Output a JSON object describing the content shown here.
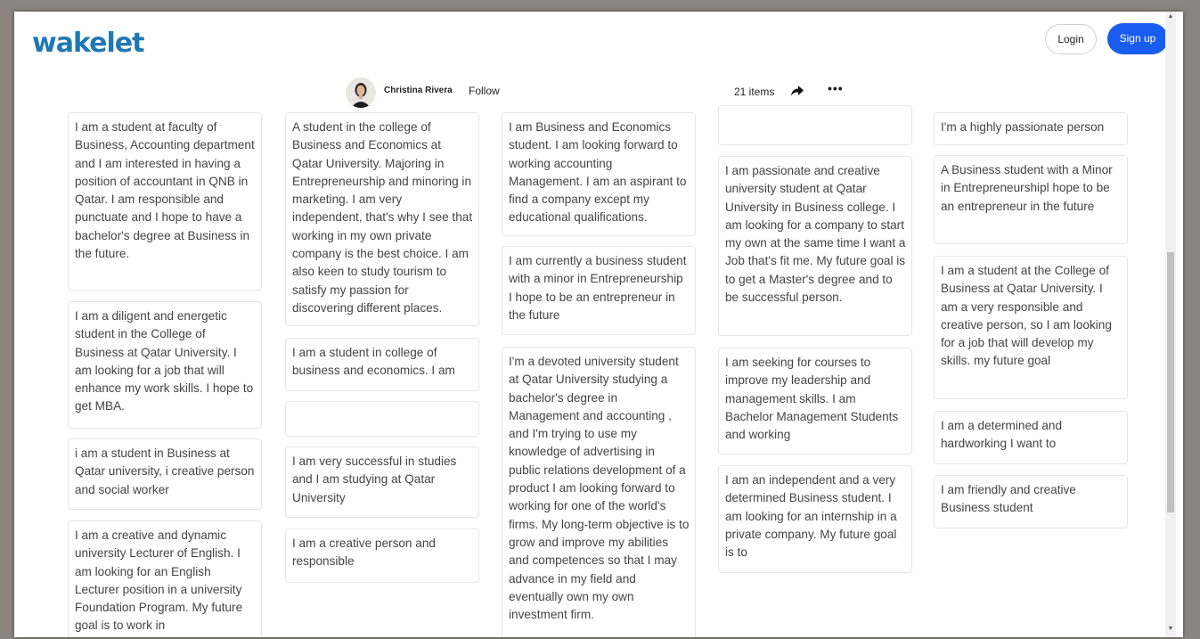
{
  "header": {
    "logo": "wakelet",
    "login_label": "Login",
    "signup_label": "Sign up"
  },
  "collection": {
    "author_name": "Christina Rivera",
    "follow_label": "Follow",
    "items_count": "21 items",
    "more_label": "•••"
  },
  "columns": [
    {
      "cards": [
        "I am a student at faculty of Business, Accounting department and I am interested in having a position of accountant in QNB in Qatar. I am responsible and punctuate and I hope to have a bachelor's degree at Business in the future.",
        "I am a diligent and energetic student in the College of Business at Qatar University. I am looking for a job that will enhance my work skills. I hope to get MBA.",
        "i am a student in Business at Qatar university, i creative person and social worker",
        "I am a creative and dynamic university Lecturer of English. I am looking for an English Lecturer position in a university Foundation Program. My future goal is to work in"
      ]
    },
    {
      "cards": [
        "A student in the college of Business and Economics at Qatar University. Majoring in Entrepreneurship and minoring in marketing. I am very independent, that's why I see that working in my own private company is the best choice. I am also keen to study tourism to satisfy my passion for discovering different places.",
        "I am a student in college of business and economics. I am",
        "",
        "I am very successful in studies and I am studying at Qatar University",
        "I am a creative person and responsible"
      ]
    },
    {
      "cards": [
        "I am Business and Economics student. I am looking forward to working accounting Management. I am an aspirant to find a company except my educational qualifications.",
        "I am currently a business student with a minor in Entrepreneurship I hope to be an entrepreneur in the future",
        "I'm a devoted university student at Qatar University studying a bachelor's degree in Management and accounting , and I'm trying to use my knowledge of advertising in public relations development of a product I am looking forward to working for one of the world's firms. My long-term objective is to grow and improve my abilities and competences so that I may advance in my field and eventually own my own investment firm."
      ]
    },
    {
      "cards": [
        "",
        "I am passionate and creative university student at Qatar University in Business college. I am looking for a company to start my own at the same time I want a Job that's fit me. My future goal is to get a Master's degree and to be successful person.",
        "I am seeking for courses to improve my leadership and management skills. I am Bachelor Management Students and working",
        "I am an independent and a very determined Business student. I am looking for an internship in a private company. My future goal is to"
      ]
    },
    {
      "cards": [
        "I'm a highly passionate person",
        "A Business student with a Minor in Entrepreneurshipl hope to be an entrepreneur in the future",
        "I am a student at the College of Business at Qatar University. I am a very responsible and creative person, so I am looking for a job that will develop my skills. my future goal",
        "I am a determined and hardworking I want to",
        "I am friendly and creative Business student"
      ]
    }
  ],
  "colors": {
    "brand": "#1f78b4",
    "signup_bg": "#1a5cf0"
  }
}
